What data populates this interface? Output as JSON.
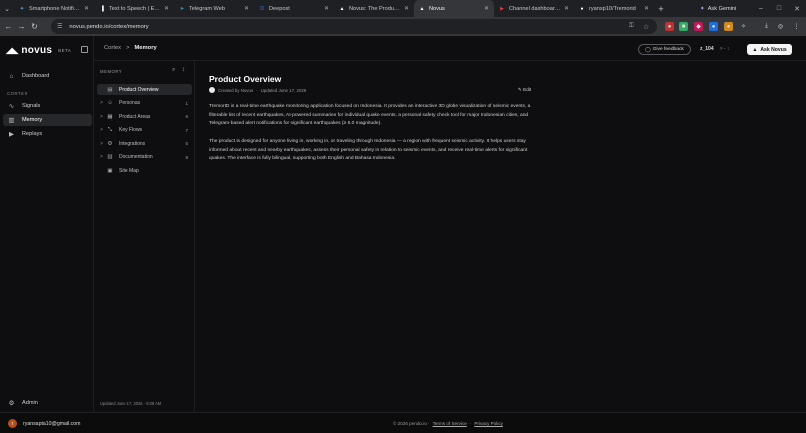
{
  "browser": {
    "tabs": [
      {
        "label": "Smartphone Notificati",
        "color": "#7aa7ff",
        "glyph": "✦"
      },
      {
        "label": "Text to Speech | Eleve",
        "color": "#eeeeee",
        "glyph": "▐"
      },
      {
        "label": "Telegram Web",
        "color": "#2ea6e0",
        "glyph": "➤"
      },
      {
        "label": "Deepost",
        "color": "#3b7bff",
        "glyph": "D"
      },
      {
        "label": "Novus: The Product A",
        "color": "#ffffff",
        "glyph": "▲"
      },
      {
        "label": "Novus",
        "color": "#ffffff",
        "glyph": "▲"
      },
      {
        "label": "Channel dashboard -",
        "color": "#e53935",
        "glyph": "▶"
      },
      {
        "label": "ryansp10/Tremorid",
        "color": "#ffffff",
        "glyph": "●"
      }
    ],
    "active_tab_index": 5,
    "gemini_label": "Ask Gemini",
    "url": "novus.pendo.io/cortex/memory"
  },
  "app": {
    "brand": "novus",
    "beta": "BETA",
    "nav": {
      "dashboard": "Dashboard",
      "section": "CORTEX",
      "signals": "Signals",
      "memory": "Memory",
      "replays": "Replays",
      "admin": "Admin"
    },
    "breadcrumb": {
      "parent": "Cortex",
      "separator": ">",
      "current": "Memory"
    },
    "feedback_label": "Give feedback",
    "user_id": "z_104",
    "user_sep": ">  -  ↕",
    "ask_label": "Ask Novus",
    "memory_panel": {
      "heading": "MEMORY",
      "items": [
        {
          "label": "Product Overview",
          "count": "",
          "icon": "▤",
          "chevron": ""
        },
        {
          "label": "Personas",
          "count": "1",
          "icon": "☺",
          "chevron": ">"
        },
        {
          "label": "Product Areas",
          "count": "6",
          "icon": "▦",
          "chevron": ">"
        },
        {
          "label": "Key Flows",
          "count": "7",
          "icon": "⤡",
          "chevron": ">"
        },
        {
          "label": "Integrations",
          "count": "5",
          "icon": "⚙",
          "chevron": ">"
        },
        {
          "label": "Documentation",
          "count": "8",
          "icon": "▥",
          "chevron": ">"
        },
        {
          "label": "Site Map",
          "count": "",
          "icon": "▣",
          "chevron": ""
        }
      ],
      "footer": "Updated June 17, 2026 · 8:08 AM"
    },
    "page": {
      "title": "Product Overview",
      "created_by": "Created by Novus",
      "dot": "·",
      "updated": "Updated June 17, 2026",
      "edit_label": "Edit",
      "paragraph1": "TremorID is a real-time earthquake monitoring application focused on Indonesia. It provides an interactive 3D globe visualization of seismic events, a filterable list of recent earthquakes, AI-powered summaries for individual quake events, a personal safety check tool for major Indonesian cities, and Telegram-based alert notifications for significant earthquakes (≥ 5.0 magnitude).",
      "paragraph2": "The product is designed for anyone living in, working in, or traveling through Indonesia — a region with frequent seismic activity. It helps users stay informed about recent and nearby earthquakes, assess their personal safety in relation to seismic events, and receive real-time alerts for significant quakes. The interface is fully bilingual, supporting both English and Bahasa Indonesia."
    },
    "footer": {
      "email": "ryansapta10@gmail.com",
      "avatar_letter": "r",
      "copyright": "© 2026 pendo.io ·",
      "terms": "Terms of Service",
      "dot": "·",
      "privacy": "Privacy Policy"
    }
  }
}
